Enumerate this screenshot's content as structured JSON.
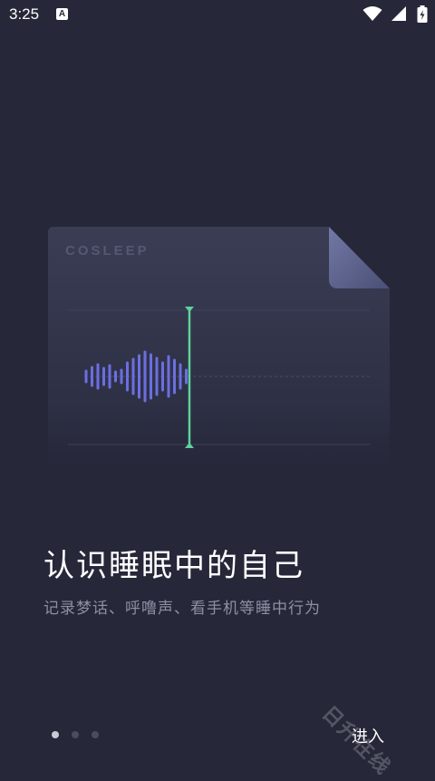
{
  "status_bar": {
    "time": "3:25",
    "notification_icon": "a-badge-icon",
    "icons": [
      "wifi-icon",
      "signal-icon",
      "battery-charging-icon"
    ]
  },
  "card": {
    "brand": "COSLEEP",
    "icons": [
      "folded-corner",
      "waveform",
      "playhead-cursor"
    ]
  },
  "headline": "认识睡眠中的自己",
  "subtitle": "记录梦话、呼噜声、看手机等睡中行为",
  "pagination": {
    "total": 3,
    "active_index": 0
  },
  "enter_label": "进入",
  "watermark": "日升在线",
  "colors": {
    "background": "#262739",
    "waveform": "#6b6fe0",
    "cursor": "#5fd19b",
    "card_fold": "#636a96"
  }
}
